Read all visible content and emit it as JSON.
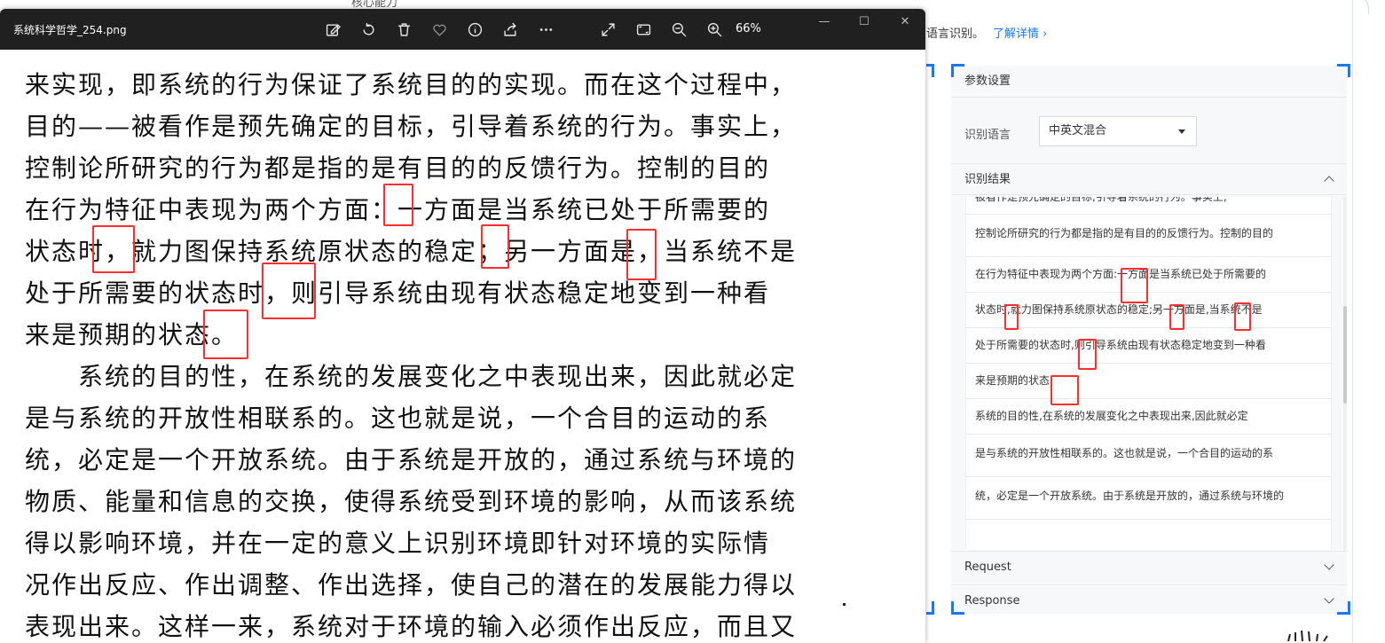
{
  "background": {
    "top_cut_text": "核心能力",
    "intro_text": "语言识别。",
    "learn_more": "了解详情 ›"
  },
  "viewer": {
    "filename": "系统科学哲学_254.png",
    "zoom": "66%",
    "toolbar_icons": [
      "edit-icon",
      "rotate-icon",
      "delete-icon",
      "favorite-icon",
      "info-icon",
      "share-icon",
      "more-icon",
      "expand-icon",
      "fit-icon",
      "zoom-out-icon",
      "zoom-in-icon"
    ],
    "window_buttons": [
      "—",
      "☐",
      "✕"
    ],
    "doc_lines": [
      "来实现，即系统的行为保证了系统目的的实现。而在这个过程中，",
      "目的——被看作是预先确定的目标，引导着系统的行为。事实上，",
      "控制论所研究的行为都是指的是有目的的反馈行为。控制的目的",
      "在行为特征中表现为两个方面：一方面是当系统已处于所需要的",
      "状态时，就力图保持系统原状态的稳定；另一方面是，当系统不是",
      "处于所需要的状态时，则引导系统由现有状态稳定地变到一种看",
      "来是预期的状态。",
      "系统的目的性，在系统的发展变化之中表现出来，因此就必定",
      "是与系统的开放性相联系的。这也就是说，一个合目的运动的系",
      "统，必定是一个开放系统。由于系统是开放的，通过系统与环境的",
      "物质、能量和信息的交换，使得系统受到环境的影响，从而该系统",
      "得以影响环境，并在一定的意义上识别环境即针对环境的实际情",
      "况作出反应、作出调整、作出选择，使自己的潜在的发展能力得以",
      "表现出来。这样一来，系统对于环境的输入必须作出反应，而且又"
    ]
  },
  "panel": {
    "params_title": "参数设置",
    "lang_label": "识别语言",
    "lang_value": "中英文混合",
    "result_title": "识别结果",
    "results": [
      "被看作是预先确定的目标,引导着系统的行为。事实上,",
      "控制论所研究的行为都是指的是有目的的反馈行为。控制的目的",
      "在行为特征中表现为两个方面:一方面是当系统已处于所需要的",
      "状态时,就力图保持系统原状态的稳定;另一方面是,当系统不是",
      "处于所需要的状态时,则引导系统由现有状态稳定地变到一种看",
      "来是预期的状态.",
      "系统的目的性,在系统的发展变化之中表现出来,因此就必定",
      "是与系统的开放性相联系的。这也就是说，一个合目的运动的系",
      "统，必定是一个开放系统。由于系统是开放的，通过系统与环境的"
    ],
    "request_title": "Request",
    "response_title": "Response"
  },
  "colors": {
    "accent": "#1677ff",
    "highlight": "#ff2d2d",
    "titlebar": "#202020"
  }
}
